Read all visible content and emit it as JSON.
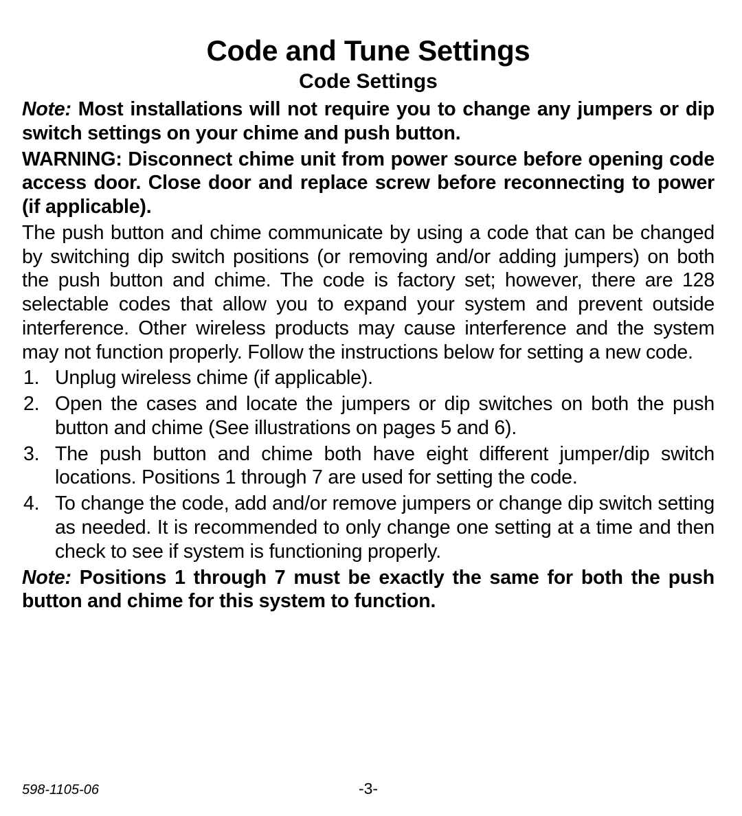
{
  "title": "Code and Tune Settings",
  "subtitle": "Code Settings",
  "note1_label": "Note:",
  "note1_body": " Most installations will not require you to change any jumpers or dip switch settings on your chime and push button.",
  "warning": "WARNING: Disconnect chime unit from power source before opening code access door. Close door and replace screw before reconnecting to power (if applicable).",
  "intro": "The push button and chime communicate by using a code that can be changed by switching dip switch positions (or removing and/or adding jumpers) on both the push button and chime. The code is factory set; however, there are 128 selectable codes that allow you to expand your system and prevent outside interference. Other wireless products may cause interference and the system may not function properly. Follow the instructions below for setting a new code.",
  "steps": [
    "Unplug wireless chime (if applicable).",
    "Open the cases and locate the jumpers or dip switches on both the push button and chime (See illustrations on pages 5 and 6).",
    "The push button and chime both have eight different jumper/dip switch locations. Positions 1 through 7 are used for setting the code.",
    "To change the code, add and/or remove jumpers or change dip switch setting as needed. It is recommended to only change one setting at a time and then check to see if system is functioning properly."
  ],
  "note2_label": "Note:",
  "note2_body": " Positions 1 through 7 must be exactly the same for both the push button and chime for this system to function.",
  "doc_num": "598-1105-06",
  "page_num": "-3-"
}
